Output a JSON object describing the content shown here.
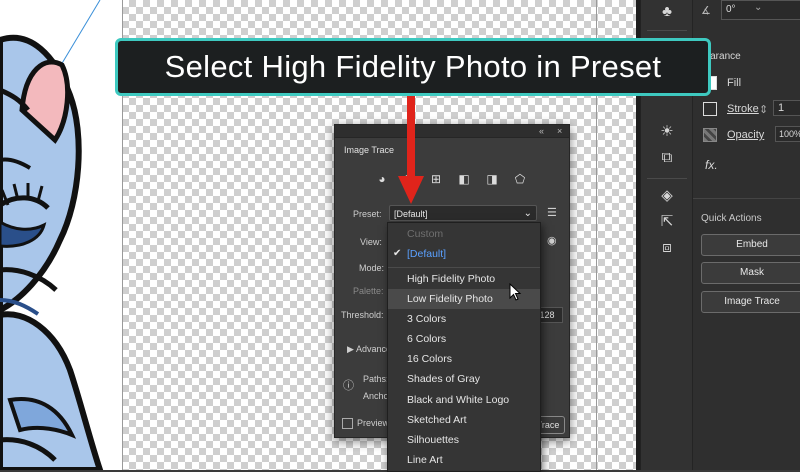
{
  "callout": {
    "text": "Select High Fidelity Photo in Preset"
  },
  "toolstrip": {
    "icons": [
      "club-icon",
      "sun-icon",
      "brush-icon",
      "pages-icon",
      "fx-icon",
      "layers-icon",
      "export-icon",
      "artboards-icon"
    ]
  },
  "properties": {
    "angle_value": "0°",
    "appearance_label": "pearance",
    "fill_label": "Fill",
    "stroke_label": "Stroke",
    "stroke_value": "1",
    "opacity_label": "Opacity",
    "opacity_value": "100%",
    "fx_label": "fx.",
    "quick_actions_label": "Quick Actions",
    "embed_label": "Embed",
    "mask_label": "Mask",
    "image_trace_label": "Image Trace"
  },
  "image_trace": {
    "title": "Image Trace",
    "preset_label": "Preset:",
    "preset_value": "[Default]",
    "view_label": "View:",
    "mode_label": "Mode:",
    "palette_label": "Palette:",
    "threshold_label": "Threshold:",
    "threshold_value": "128",
    "advanced_label": "Advanced",
    "paths_label": "Paths:",
    "anchors_label": "Anchors:",
    "preview_label": "Preview",
    "trace_button": "Trace"
  },
  "preset_dropdown": {
    "options": [
      {
        "label": "Custom",
        "state": "disabled"
      },
      {
        "label": "[Default]",
        "state": "selected"
      },
      {
        "label": "High Fidelity Photo",
        "state": "normal"
      },
      {
        "label": "Low Fidelity Photo",
        "state": "hover"
      },
      {
        "label": "3 Colors",
        "state": "normal"
      },
      {
        "label": "6 Colors",
        "state": "normal"
      },
      {
        "label": "16 Colors",
        "state": "normal"
      },
      {
        "label": "Shades of Gray",
        "state": "normal"
      },
      {
        "label": "Black and White Logo",
        "state": "normal"
      },
      {
        "label": "Sketched Art",
        "state": "normal"
      },
      {
        "label": "Silhouettes",
        "state": "normal"
      },
      {
        "label": "Line Art",
        "state": "normal"
      }
    ]
  },
  "colors": {
    "callout_border": "#3ec9c0",
    "arrow": "#e0241b",
    "selected_option": "#5aa0ff"
  }
}
